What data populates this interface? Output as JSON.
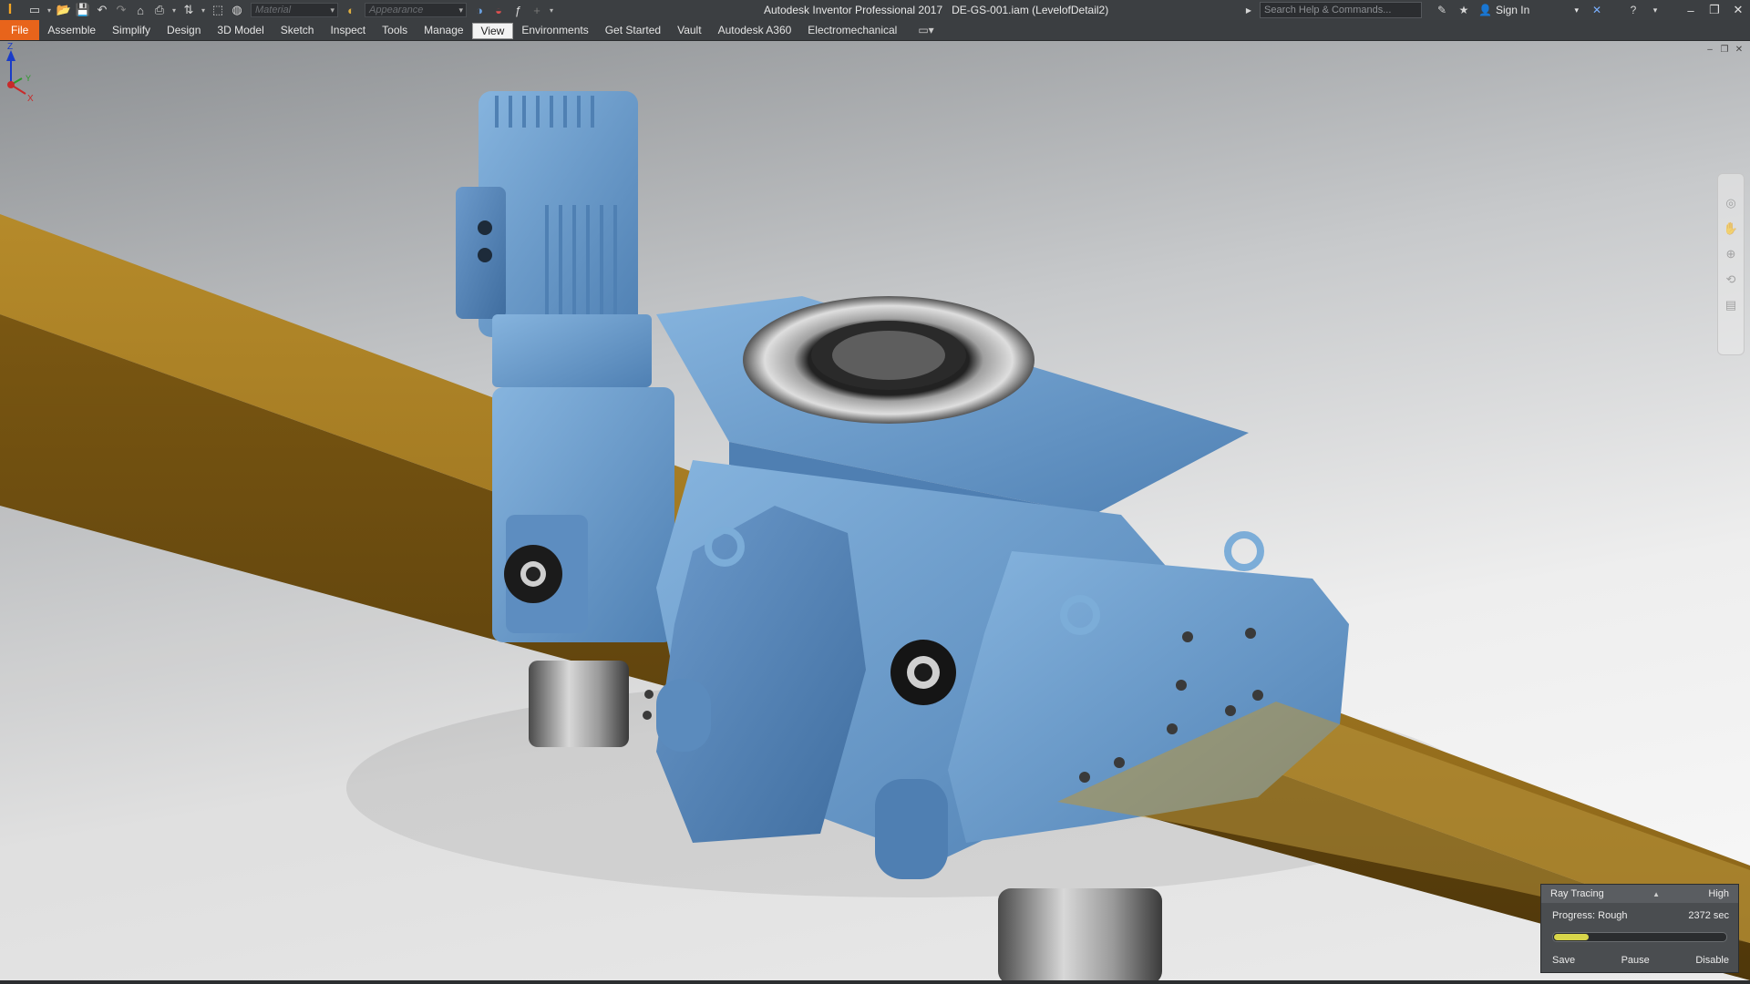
{
  "titlebar": {
    "app_title": "Autodesk Inventor Professional 2017",
    "document": "DE-GS-001.iam (LevelofDetail2)",
    "material_placeholder": "Material",
    "appearance_placeholder": "Appearance",
    "search_placeholder": "Search Help & Commands...",
    "sign_in": "Sign In"
  },
  "tabs": [
    {
      "label": "File"
    },
    {
      "label": "Assemble"
    },
    {
      "label": "Simplify"
    },
    {
      "label": "Design"
    },
    {
      "label": "3D Model"
    },
    {
      "label": "Sketch"
    },
    {
      "label": "Inspect"
    },
    {
      "label": "Tools"
    },
    {
      "label": "Manage"
    },
    {
      "label": "View",
      "active": true
    },
    {
      "label": "Environments"
    },
    {
      "label": "Get Started"
    },
    {
      "label": "Vault"
    },
    {
      "label": "Autodesk A360"
    },
    {
      "label": "Electromechanical"
    }
  ],
  "triad": {
    "z": "Z",
    "y": "Y",
    "x": "X"
  },
  "ray_tracing": {
    "title": "Ray Tracing",
    "quality": "High",
    "progress_label": "Progress: Rough",
    "time": "2372 sec",
    "progress_fraction": 0.2,
    "save": "Save",
    "pause": "Pause",
    "disable": "Disable"
  },
  "colors": {
    "accent_file_tab": "#e8641b",
    "model_blue": "#6f9fcc",
    "rail_gold": "#9a7420",
    "progress_fill": "#d8d64a"
  }
}
